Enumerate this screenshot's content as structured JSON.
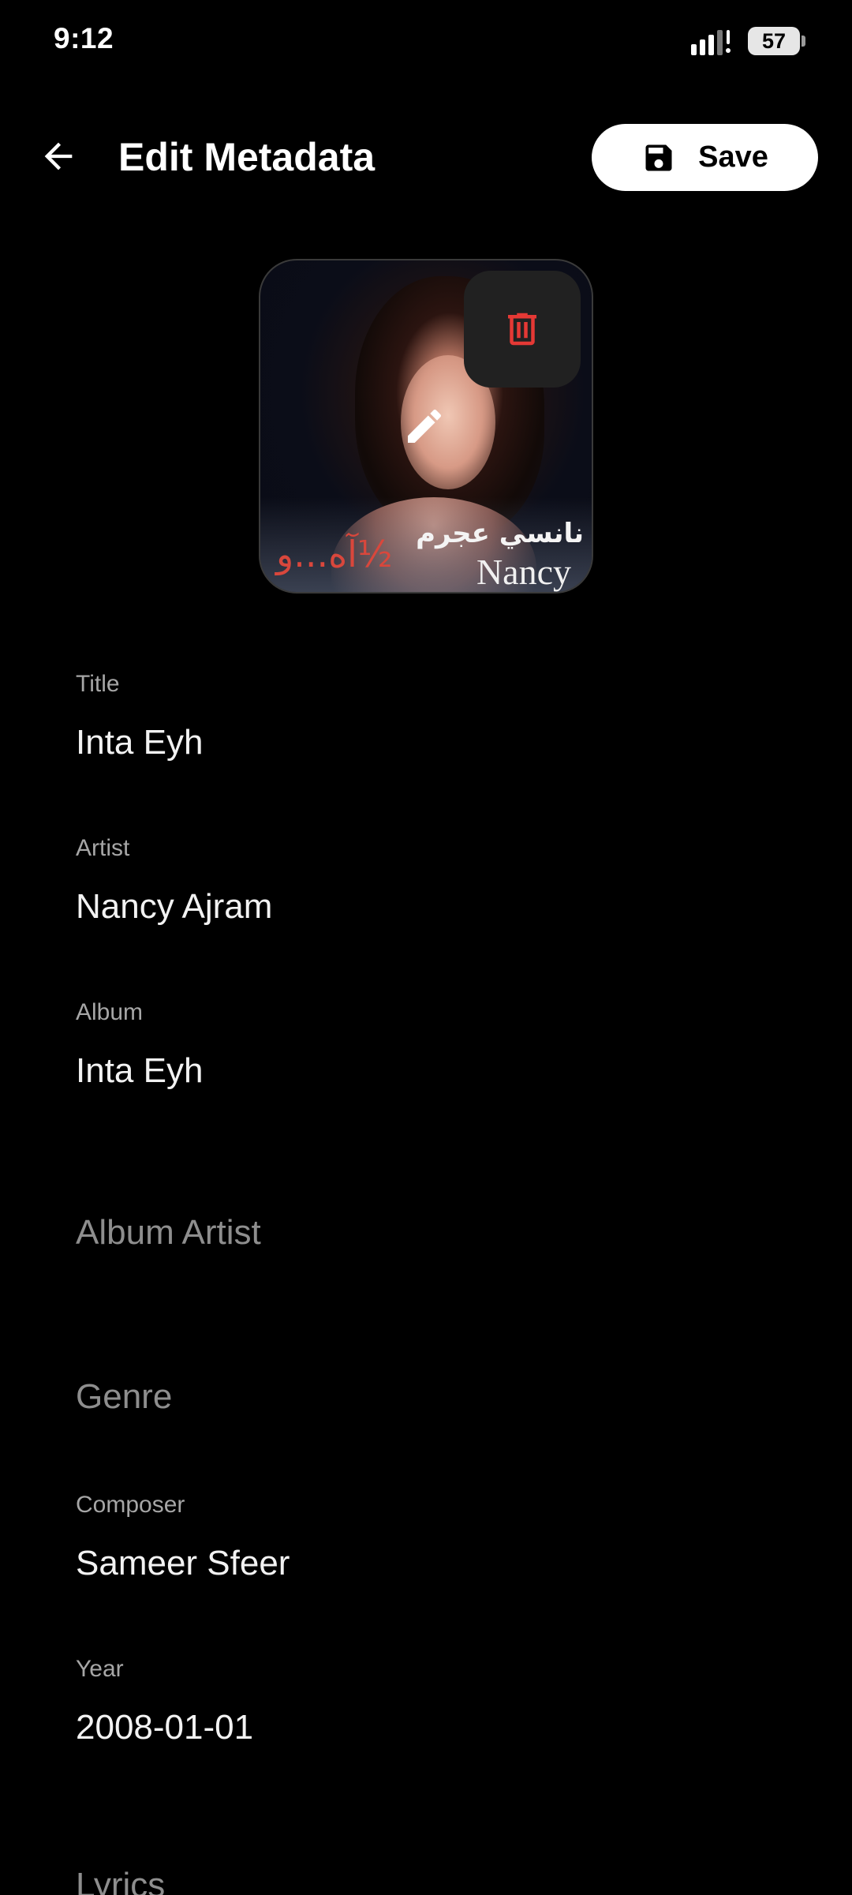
{
  "status_bar": {
    "time": "9:12",
    "battery": "57",
    "signal_icon": "signal-icon"
  },
  "app_bar": {
    "title": "Edit Metadata",
    "back_icon": "arrow-back-icon",
    "save_label": "Save",
    "save_icon": "save-icon"
  },
  "artwork": {
    "arabic_text": "نانسي عجرم",
    "latin_text": "Nancy",
    "arabic_album": "آه...و½",
    "delete_icon": "trash-icon",
    "edit_icon": "pencil-icon",
    "delete_color": "#e53935"
  },
  "fields": {
    "title": {
      "label": "Title",
      "value": "Inta Eyh"
    },
    "artist": {
      "label": "Artist",
      "value": "Nancy Ajram"
    },
    "album": {
      "label": "Album",
      "value": "Inta Eyh"
    },
    "album_artist": {
      "placeholder": "Album Artist"
    },
    "genre": {
      "placeholder": "Genre"
    },
    "composer": {
      "label": "Composer",
      "value": "Sameer Sfeer"
    },
    "year": {
      "label": "Year",
      "value": "2008-01-01"
    },
    "lyrics": {
      "placeholder": "Lyrics"
    }
  }
}
